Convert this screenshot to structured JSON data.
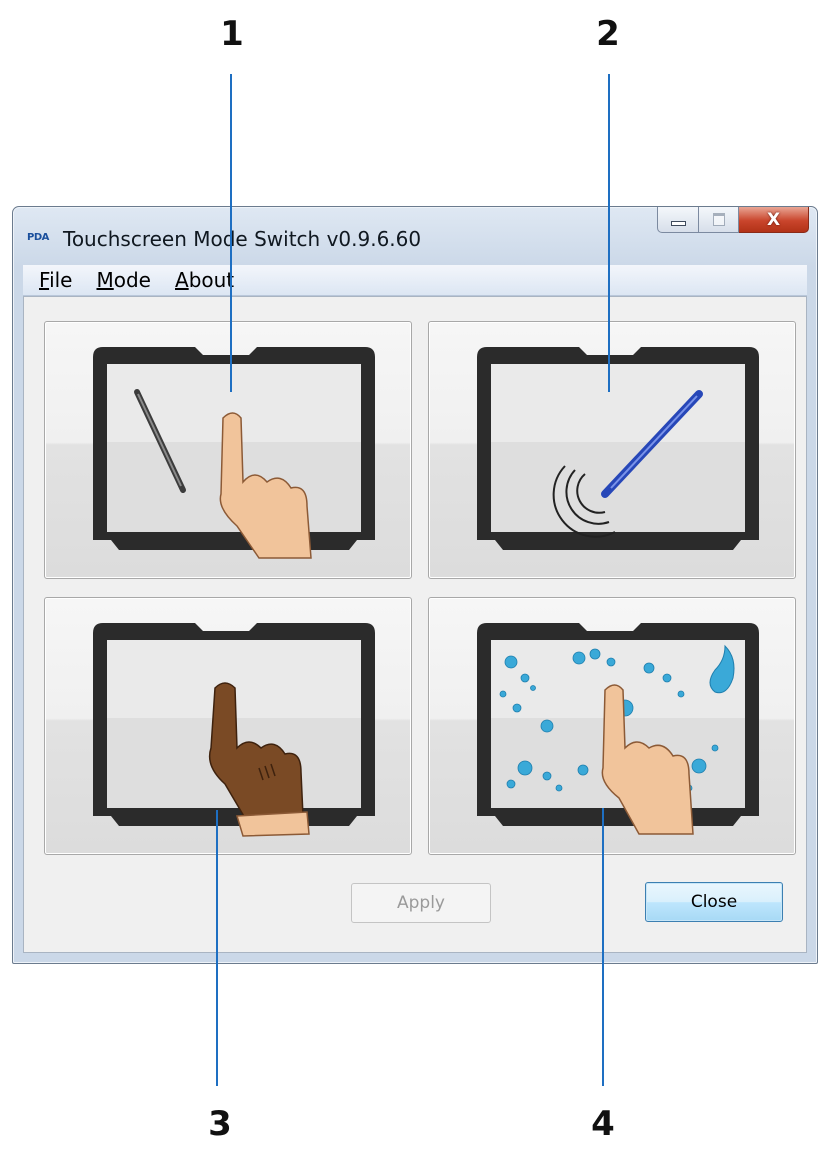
{
  "window": {
    "title": "Touchscreen Mode Switch v0.9.6.60",
    "app_icon_text": "PDA",
    "controls": {
      "minimize_icon": "minimize-icon",
      "maximize_icon": "maximize-icon",
      "close_label": "X"
    }
  },
  "menu": [
    {
      "accel": "F",
      "rest": "ile"
    },
    {
      "accel": "M",
      "rest": "ode"
    },
    {
      "accel": "A",
      "rest": "bout"
    }
  ],
  "modes": [
    {
      "icon": "pen-and-finger-touch-icon"
    },
    {
      "icon": "digitizer-pen-icon"
    },
    {
      "icon": "glove-touch-icon"
    },
    {
      "icon": "wet-finger-touch-icon"
    }
  ],
  "buttons": {
    "apply": "Apply",
    "close": "Close"
  },
  "callouts": [
    "1",
    "2",
    "3",
    "4"
  ],
  "colors": {
    "callout_line": "#1e6fc2",
    "bezel": "#2b2b2b",
    "skin": "#f1c49b",
    "glove": "#7a4a25",
    "pen_blue": "#2747b8",
    "water": "#3aa9d8"
  }
}
